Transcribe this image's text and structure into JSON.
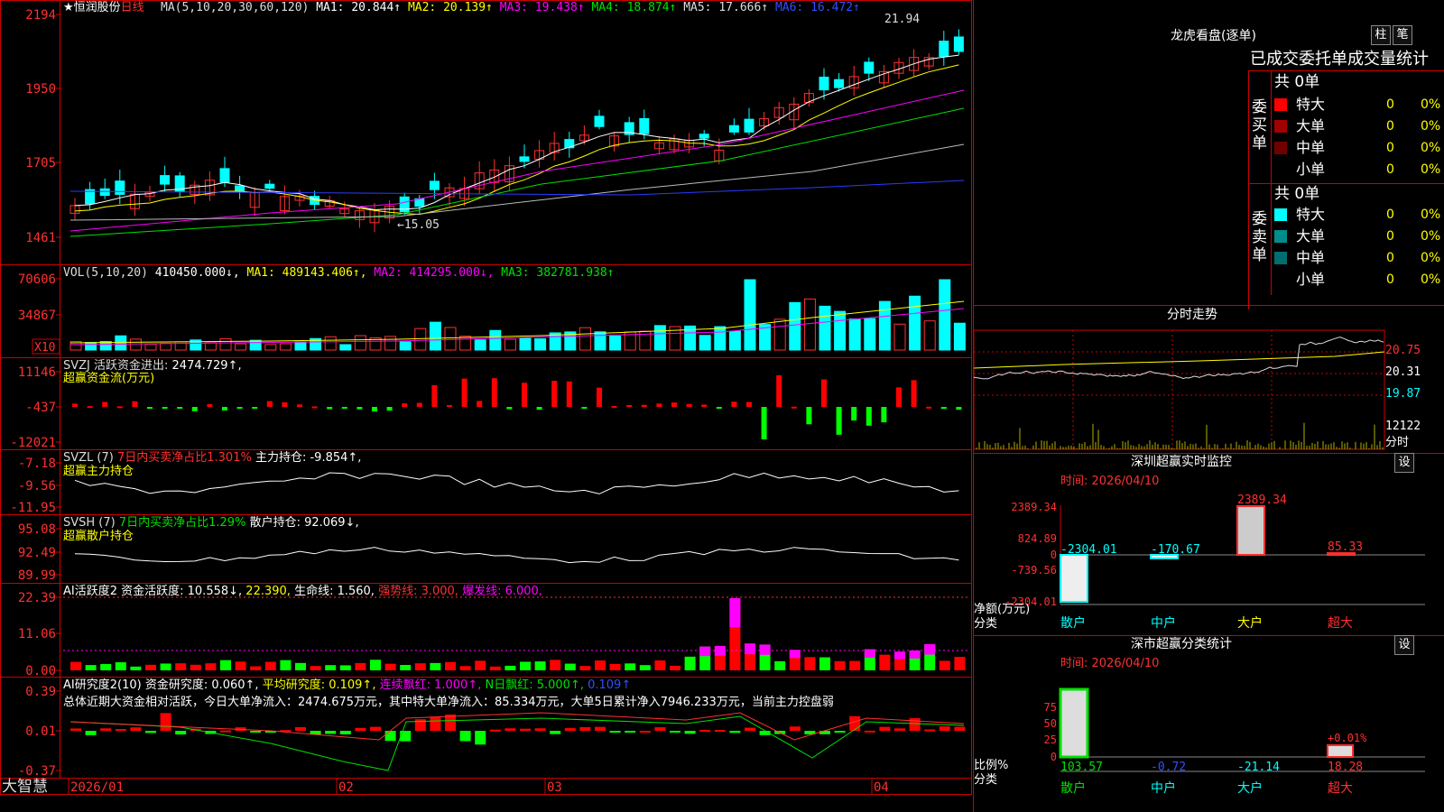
{
  "stock": {
    "name": "★恒润股份",
    "period": "日线",
    "ma_line": [
      {
        "text": "MA(5,10,20,30,60,120)",
        "color": "#dddddd"
      },
      {
        "text": " MA1: 20.844↑",
        "color": "#ffffff"
      },
      {
        "text": " MA2: 20.139↑",
        "color": "#ffff00"
      },
      {
        "text": " MA3: 19.438↑",
        "color": "#ff00ff"
      },
      {
        "text": " MA4: 18.874↑",
        "color": "#00e000"
      },
      {
        "text": " MA5: 17.666↑",
        "color": "#dddddd"
      },
      {
        "text": " MA6: 16.472↑",
        "color": "#3050ff"
      }
    ],
    "price_axis": [
      "2194",
      "1950",
      "1705",
      "1461"
    ],
    "high_label": "21.94",
    "low_label": "←15.05",
    "vol_line": [
      {
        "text": "VOL(5,10,20) ",
        "color": "#dddddd"
      },
      {
        "text": "410450.000↓, ",
        "color": "#ffffff"
      },
      {
        "text": "MA1: 489143.406↑, ",
        "color": "#ffff00"
      },
      {
        "text": "MA2: 414295.000↓, ",
        "color": "#ff00ff"
      },
      {
        "text": "MA3: 382781.938↑",
        "color": "#00e000"
      }
    ],
    "vol_axis": [
      "70606",
      "34867"
    ],
    "vol_unit": "X10",
    "svzj_line": [
      {
        "text": "SVZJ  活跃资金进出: ",
        "color": "#dddddd"
      },
      {
        "text": "2474.729↑,",
        "color": "#ffffff"
      }
    ],
    "svzj_sub": "超赢资金流(万元)",
    "svzj_axis": [
      "11146",
      "-437",
      "-12021"
    ],
    "svzl_line": [
      {
        "text": "SVZL (7) ",
        "color": "#dddddd"
      },
      {
        "text": "7日内买卖净占比1.301% ",
        "color": "#ff3030"
      },
      {
        "text": "主力持仓: -9.854↑,",
        "color": "#ffffff"
      }
    ],
    "svzl_sub": "超赢主力持仓",
    "svzl_axis": [
      "-7.18",
      "-9.56",
      "-11.95"
    ],
    "svsh_line": [
      {
        "text": "SVSH (7) ",
        "color": "#dddddd"
      },
      {
        "text": "7日内买卖净占比1.29% ",
        "color": "#00e000"
      },
      {
        "text": "散户持仓: 92.069↓,",
        "color": "#ffffff"
      }
    ],
    "svsh_sub": "超赢散户持仓",
    "svsh_axis": [
      "95.08",
      "92.49",
      "89.99"
    ],
    "ai_line": [
      {
        "text": "AI活跃度2 资金活跃度: 10.558↓, ",
        "color": "#ffffff"
      },
      {
        "text": "22.390, ",
        "color": "#ffff00"
      },
      {
        "text": "生命线: 1.560, ",
        "color": "#ffffff"
      },
      {
        "text": "强势线: 3.000, ",
        "color": "#ff3030"
      },
      {
        "text": "爆发线: 6.000,",
        "color": "#ff00ff"
      }
    ],
    "ai_axis": [
      "22.39",
      "11.06",
      "0.00"
    ],
    "res_line": [
      {
        "text": "AI研究度2(10) 资金研究度: 0.060↑, ",
        "color": "#ffffff"
      },
      {
        "text": "平均研究度: 0.109↑, ",
        "color": "#ffff00"
      },
      {
        "text": "连续飘红: 1.000↑, ",
        "color": "#ff00ff"
      },
      {
        "text": "N日飘红: 5.000↑, ",
        "color": "#00e000"
      },
      {
        "text": "0.109↑",
        "color": "#3050ff"
      }
    ],
    "res_summary": "总体近期大资金相对活跃，今日大单净流入：2474.675万元，其中特大单净流入：85.334万元，大单5日累计净入7946.233万元，当前主力控盘弱",
    "res_axis": [
      "0.39",
      "0.01",
      "-0.37"
    ],
    "date_labels": [
      "2026/01",
      "02",
      "03",
      "04"
    ],
    "brand": "大智慧"
  },
  "dragon": {
    "title": "龙虎看盘(逐单)",
    "btn_zhu": "柱",
    "btn_bi": "笔",
    "tabs": "已成交委托单成交量统计",
    "buy_label": "委买单",
    "sell_label": "委卖单",
    "buy_total": "共 0单",
    "sell_total": "共 0单",
    "buy_rows": [
      {
        "label": "特大",
        "count": "0",
        "pct": "0%",
        "color": "#ff0000"
      },
      {
        "label": "大单",
        "count": "0",
        "pct": "0%",
        "color": "#a00000"
      },
      {
        "label": "中单",
        "count": "0",
        "pct": "0%",
        "color": "#700000"
      },
      {
        "label": "小单",
        "count": "0",
        "pct": "0%",
        "color": ""
      }
    ],
    "sell_rows": [
      {
        "label": "特大",
        "count": "0",
        "pct": "0%",
        "color": "#00ffff"
      },
      {
        "label": "大单",
        "count": "0",
        "pct": "0%",
        "color": "#008c8c"
      },
      {
        "label": "中单",
        "count": "0",
        "pct": "0%",
        "color": "#006e6e"
      },
      {
        "label": "小单",
        "count": "0",
        "pct": "0%",
        "color": ""
      }
    ]
  },
  "intraday": {
    "title": "分时走势",
    "axis": [
      "20.75",
      "20.31",
      "19.87",
      "12122"
    ],
    "unit": "分时"
  },
  "sz_monitor": {
    "title": "深圳超赢实时监控",
    "btn": "设",
    "time": "时间: 2026/04/10",
    "axis": [
      "2389.34",
      "824.89",
      "0",
      "-739.56",
      "-2304.01"
    ],
    "values": [
      "-2304.01",
      "-170.67",
      "2389.34",
      "85.33"
    ],
    "cats": [
      "散户",
      "中户",
      "大户",
      "超大"
    ],
    "ylabel": "净额(万元)",
    "xlabel": "分类"
  },
  "sz_class": {
    "title": "深市超赢分类统计",
    "btn": "设",
    "time": "时间: 2026/04/10",
    "axis": [
      "75",
      "50",
      "25",
      "0"
    ],
    "values": [
      "103.57",
      "-0.72",
      "-21.14",
      "18.28"
    ],
    "extra": "+0.01%",
    "cats": [
      "散户",
      "中户",
      "大户",
      "超大"
    ],
    "ylabel": "比例%",
    "xlabel": "分类"
  }
}
